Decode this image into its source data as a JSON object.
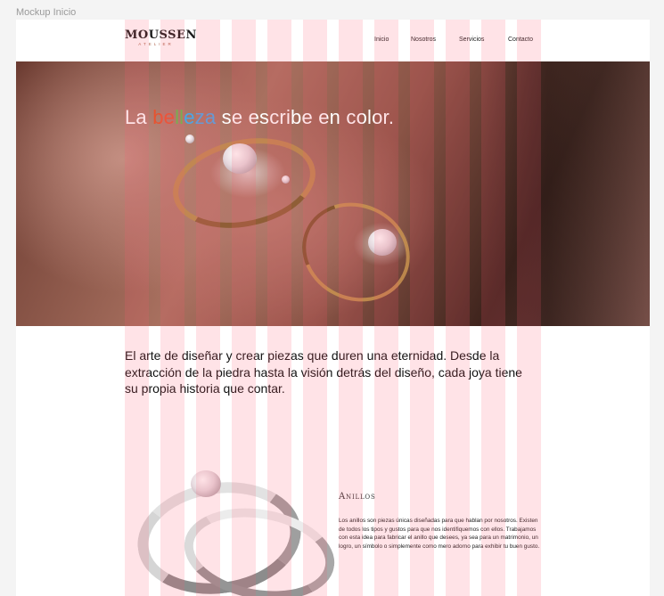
{
  "frame": {
    "label": "Mockup Inicio"
  },
  "header": {
    "logo": {
      "main": "MOUSSEN",
      "sub": "ATELIER"
    },
    "nav": [
      {
        "label": "Inicio"
      },
      {
        "label": "Nosotros"
      },
      {
        "label": "Servicios"
      },
      {
        "label": "Contacto"
      }
    ]
  },
  "hero": {
    "title_before": "La ",
    "title_highlight": [
      "be",
      "ll",
      "eza"
    ],
    "title_after": " se escribe en color.",
    "colors": {
      "red": "#e8532f",
      "green": "#5fbf4a",
      "blue": "#49a6e8"
    }
  },
  "intro": {
    "text": "El arte de diseñar y crear piezas que duren una eternidad. Desde la extracción de la piedra hasta la visión detrás del diseño, cada joya tiene su propia historia que contar."
  },
  "product": {
    "title": "Anillos",
    "description": "Los anillos son piezas únicas diseñadas para que hablan por nosotros. Existen de todos los tipos y gustos para que nos identifiquemos con ellos. Trabajamos con esta idea para fabricar el anillo que desees, ya sea para un matrimonio, un logro, un símbolo o simplemente como mero adorno para exhibir tu buen gusto."
  },
  "grid": {
    "columns": 12,
    "color": "#ff5a6e"
  }
}
